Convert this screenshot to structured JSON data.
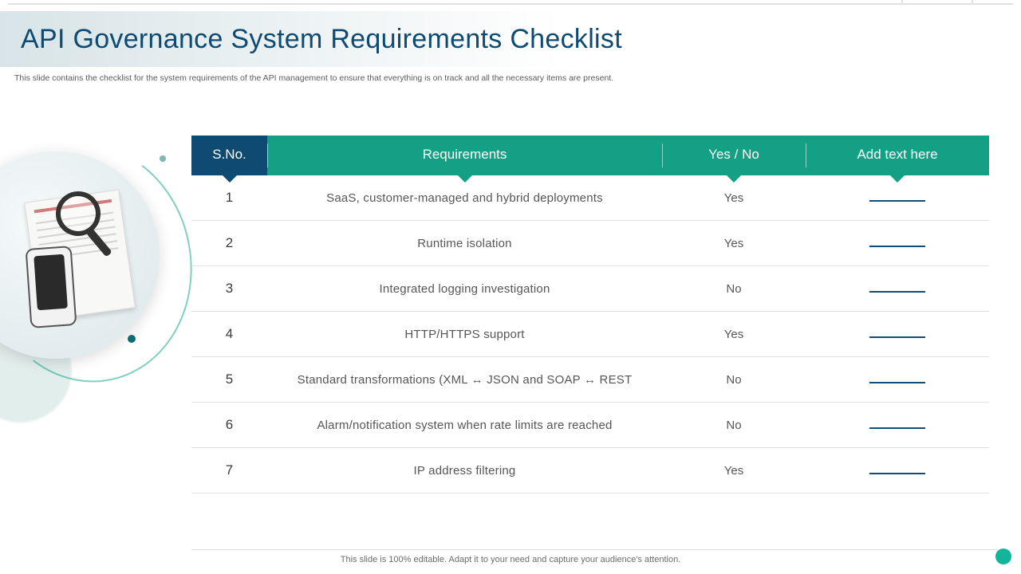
{
  "title": "API Governance System Requirements Checklist",
  "subtitle": "This slide contains the checklist for the system requirements of the API management to ensure that everything is on track and all the necessary items are present.",
  "columns": {
    "sno": "S.No.",
    "req": "Requirements",
    "yn": "Yes / No",
    "add": "Add text here"
  },
  "rows": [
    {
      "n": "1",
      "req": "SaaS, customer-managed and hybrid deployments",
      "yn": "Yes"
    },
    {
      "n": "2",
      "req": "Runtime isolation",
      "yn": "Yes"
    },
    {
      "n": "3",
      "req": "Integrated logging investigation",
      "yn": "No"
    },
    {
      "n": "4",
      "req": "HTTP/HTTPS support",
      "yn": "Yes"
    },
    {
      "n": "5",
      "req": "Standard transformations (XML ↔ JSON and SOAP ↔ REST",
      "yn": "No"
    },
    {
      "n": "6",
      "req": "Alarm/notification system when rate limits are reached",
      "yn": "No"
    },
    {
      "n": "7",
      "req": "IP address filtering",
      "yn": "Yes"
    }
  ],
  "footer": "This slide is 100% editable. Adapt it to your need and capture your audience's attention."
}
